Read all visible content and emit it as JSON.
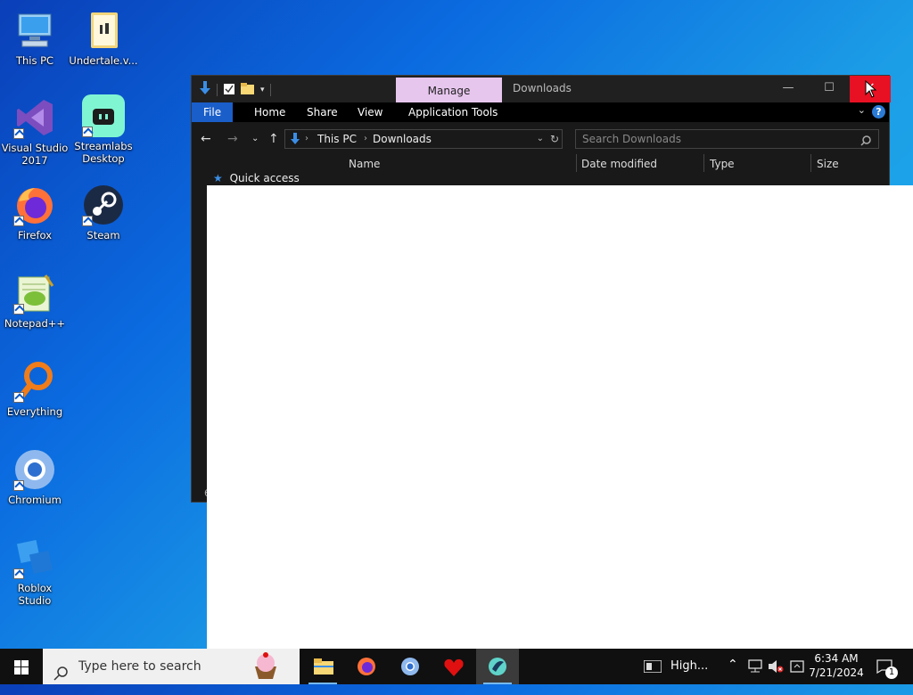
{
  "desktop": {
    "icons": [
      {
        "label": "This PC"
      },
      {
        "label": "Undertale.v..."
      },
      {
        "label": "Visual Studio\n2017"
      },
      {
        "label": "Streamlabs\nDesktop"
      },
      {
        "label": "Firefox"
      },
      {
        "label": "Steam"
      },
      {
        "label": "Notepad++"
      },
      {
        "label": "Everything"
      },
      {
        "label": "Chromium"
      },
      {
        "label": "Roblox Studio"
      }
    ]
  },
  "explorer": {
    "manage_tab": "Manage",
    "window_title": "Downloads",
    "ribbon_tabs": [
      "File",
      "Home",
      "Share",
      "View",
      "Application Tools"
    ],
    "breadcrumb": [
      "This PC",
      "Downloads"
    ],
    "search_placeholder": "Search Downloads",
    "columns": [
      "Name",
      "Date modified",
      "Type",
      "Size"
    ],
    "nav_quick_access": "Quick access",
    "status_fragment": "6"
  },
  "taskbar": {
    "search_placeholder": "Type here to search",
    "tray_app_label": "High...",
    "time": "6:34 AM",
    "date": "7/21/2024",
    "notification_count": "1"
  },
  "colors": {
    "close_button": "#e81123",
    "manage_tab": "#e7c6ee",
    "file_tab": "#1a5ec9",
    "taskbar": "#101010"
  }
}
